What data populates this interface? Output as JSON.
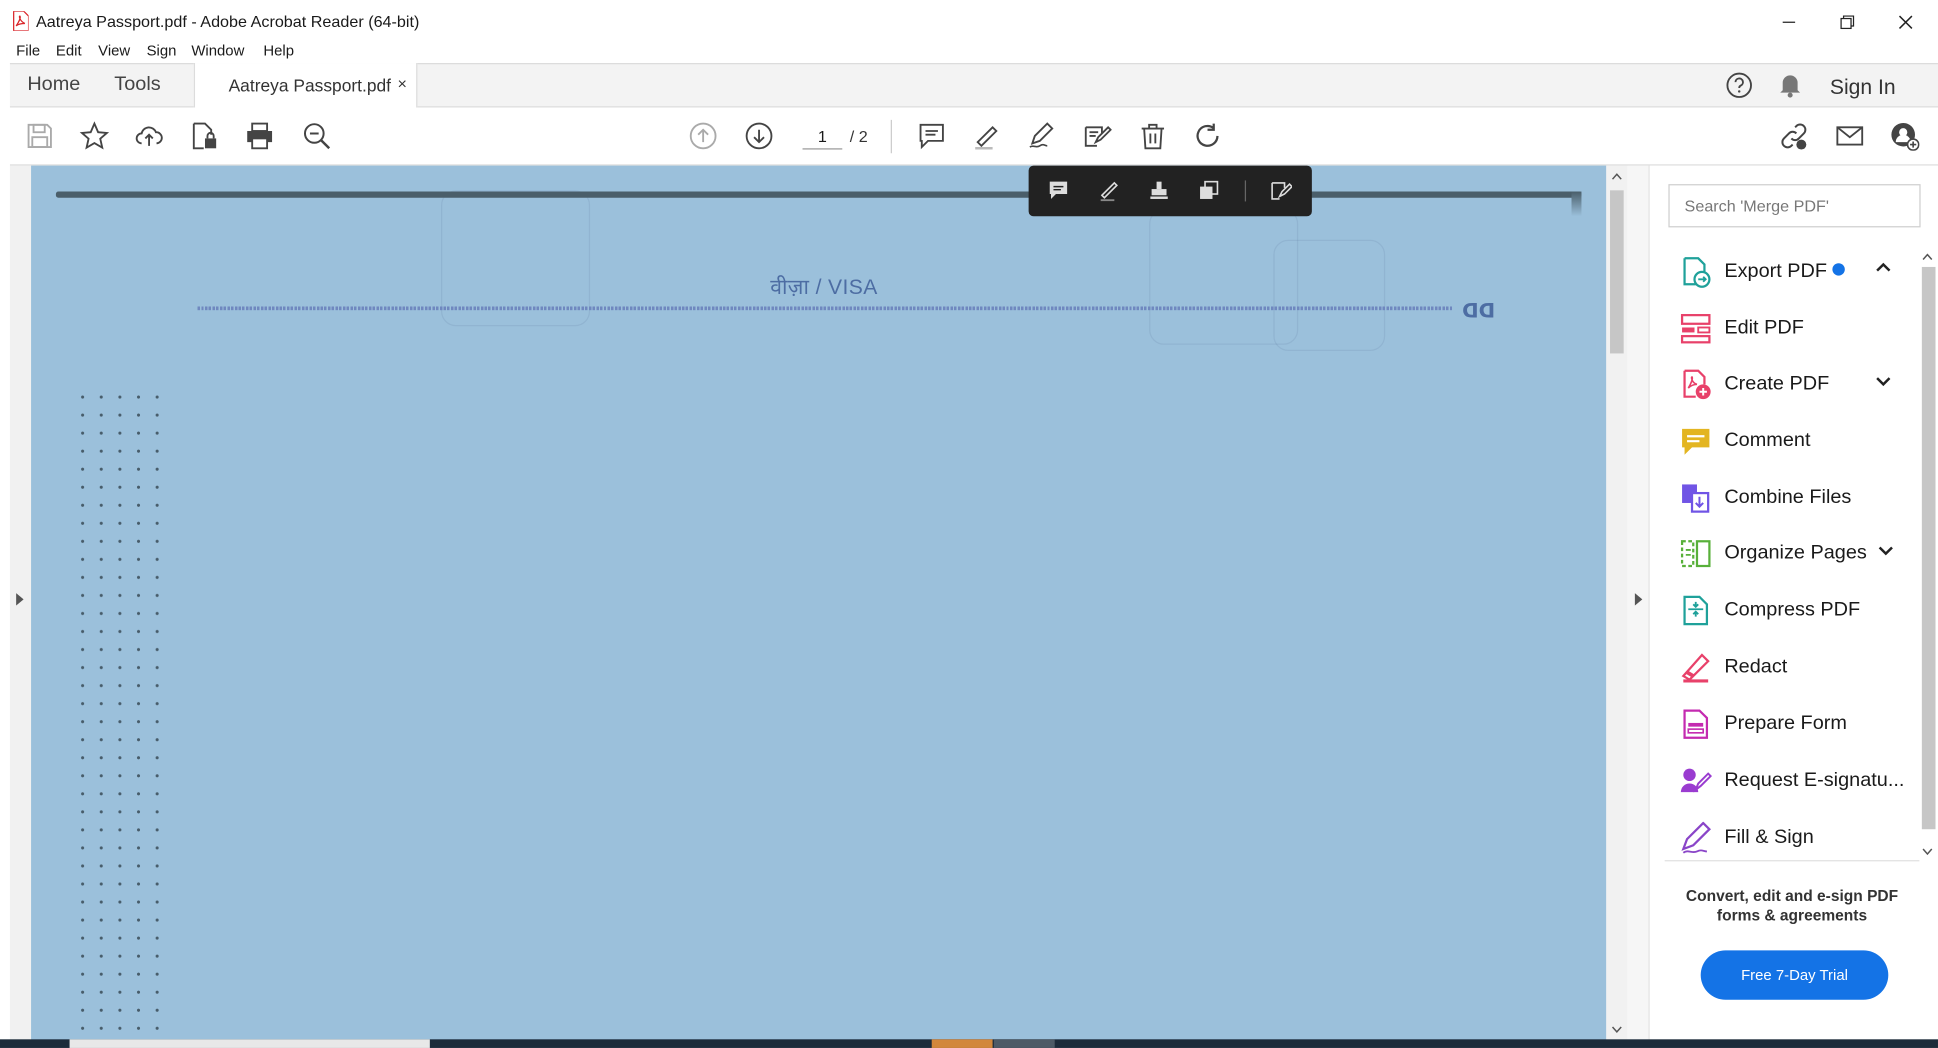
{
  "window": {
    "title": "Aatreya Passport.pdf - Adobe Acrobat Reader (64-bit)",
    "controls": [
      "minimize-icon",
      "restore-icon",
      "close-icon"
    ]
  },
  "menu": [
    "File",
    "Edit",
    "View",
    "Sign",
    "Window",
    "Help"
  ],
  "tabs": {
    "home": "Home",
    "tools": "Tools",
    "document": "Aatreya Passport.pdf",
    "close_glyph": "×"
  },
  "header_right": {
    "help_icon": "help-icon",
    "notification_icon": "bell-icon",
    "signin": "Sign In"
  },
  "toolbar": {
    "left_icons": [
      "save-icon",
      "star-icon",
      "cloud-upload-icon",
      "protect-file-icon",
      "print-icon",
      "zoom-search-icon"
    ],
    "page_current": "1",
    "page_total": "/ 2",
    "right_icons": [
      "comment-icon",
      "highlight-icon",
      "sign-icon",
      "fill-sign-icon",
      "delete-icon",
      "rotate-icon"
    ],
    "far_right_icons": [
      "share-link-icon",
      "email-icon",
      "add-user-icon"
    ]
  },
  "floating_toolbar": {
    "icons": [
      "comment-icon",
      "highlight-icon",
      "stamp-icon",
      "copy-icon",
      "edit-pdf-icon"
    ],
    "background": "#222222"
  },
  "document": {
    "visa_title": "वीज़ा / VISA",
    "visa_logo": "ᗡᗡ",
    "background": "#9bc0db"
  },
  "right_panel": {
    "search_placeholder": "Search 'Merge PDF'",
    "tools": [
      {
        "label": "Export PDF",
        "icon": "export-pdf-icon",
        "color": "#1fa19a",
        "has_new_badge": true,
        "chevron": "up"
      },
      {
        "label": "Edit PDF",
        "icon": "edit-pdf-icon",
        "color": "#e8416a"
      },
      {
        "label": "Create PDF",
        "icon": "create-pdf-icon",
        "color": "#e8416a",
        "chevron": "down"
      },
      {
        "label": "Comment",
        "icon": "comment-tool-icon",
        "color": "#e3b521"
      },
      {
        "label": "Combine Files",
        "icon": "combine-files-icon",
        "color": "#7054e5"
      },
      {
        "label": "Organize Pages",
        "icon": "organize-pages-icon",
        "color": "#58b03a",
        "chevron": "down"
      },
      {
        "label": "Compress PDF",
        "icon": "compress-pdf-icon",
        "color": "#1fa19a"
      },
      {
        "label": "Redact",
        "icon": "redact-icon",
        "color": "#e8416a"
      },
      {
        "label": "Prepare Form",
        "icon": "prepare-form-icon",
        "color": "#c42ab0"
      },
      {
        "label": "Request E-signatu...",
        "icon": "request-esign-icon",
        "color": "#9a3cd0"
      },
      {
        "label": "Fill & Sign",
        "icon": "fill-sign-tool-icon",
        "color": "#8a45c8"
      }
    ],
    "promo_text": "Convert, edit and e-sign PDF forms & agreements",
    "trial_button": "Free 7-Day Trial",
    "accent": "#1473e6"
  }
}
